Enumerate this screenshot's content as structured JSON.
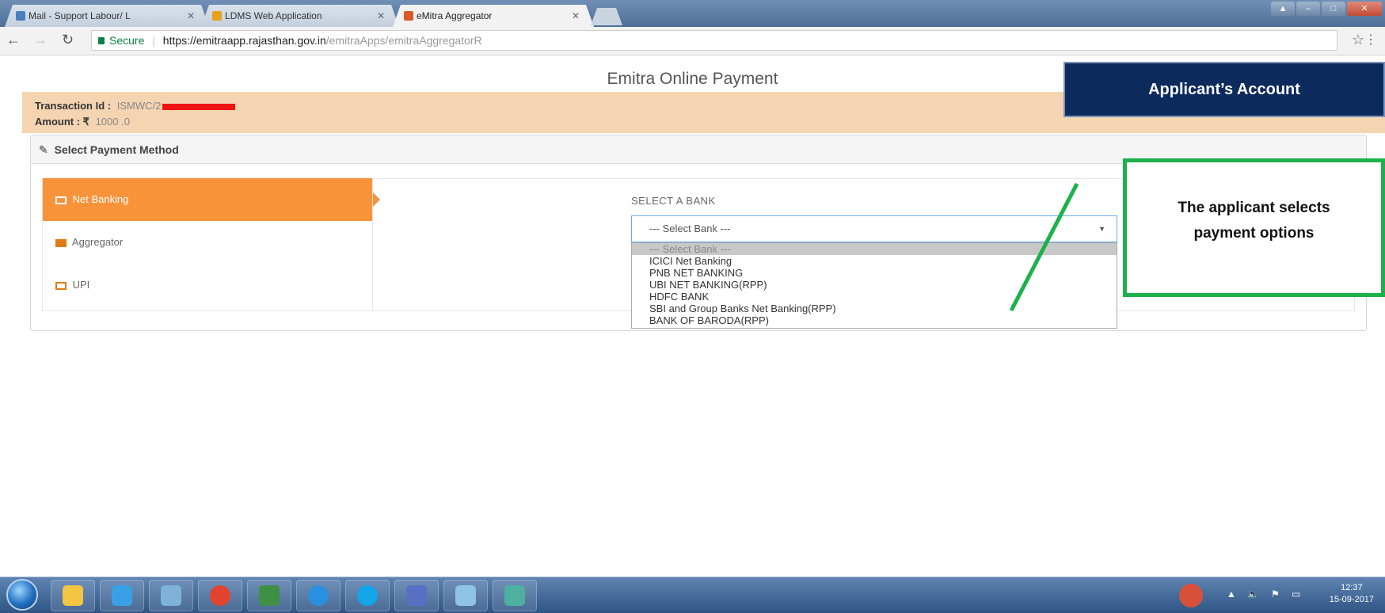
{
  "browser": {
    "tabs": [
      {
        "label": "Mail - Support Labour/ L",
        "icon_color": "#4a7fc1"
      },
      {
        "label": "LDMS Web Application",
        "icon_color": "#e6a21b"
      },
      {
        "label": "eMitra Aggregator",
        "icon_color": "#d85a2a"
      }
    ],
    "secure_label": "Secure",
    "url_host": "https://emitraapp.rajasthan.gov.in",
    "url_path": "/emitraApps/emitraAggregatorR"
  },
  "page": {
    "title": "Emitra Online Payment",
    "transaction_label": "Transaction Id :",
    "transaction_value": "ISMWC/2",
    "amount_label": "Amount : ₹",
    "amount_value": "1000 .0",
    "panel_title": "Select Payment Method",
    "methods": [
      {
        "label": "Net Banking",
        "icon": "card-icon"
      },
      {
        "label": "Aggregator",
        "icon": "bank-icon"
      },
      {
        "label": "UPI",
        "icon": "upi-icon"
      }
    ],
    "bank_label": "SELECT A BANK",
    "bank_selected": "--- Select Bank ---",
    "bank_options": [
      "--- Select Bank ---",
      "ICICI Net Banking",
      "PNB NET BANKING",
      "UBI NET BANKING(RPP)",
      "HDFC BANK",
      "SBI and Group Banks Net Banking(RPP)",
      "BANK OF BARODA(RPP)"
    ]
  },
  "annotations": {
    "account_label": "Applicant’s Account",
    "callout_line1": "The applicant selects",
    "callout_line2": "payment options",
    "callout_color": "#1db14b",
    "account_color": "#0d2a5c"
  },
  "taskbar": {
    "time": "12:37",
    "date": "15-09-2017"
  }
}
